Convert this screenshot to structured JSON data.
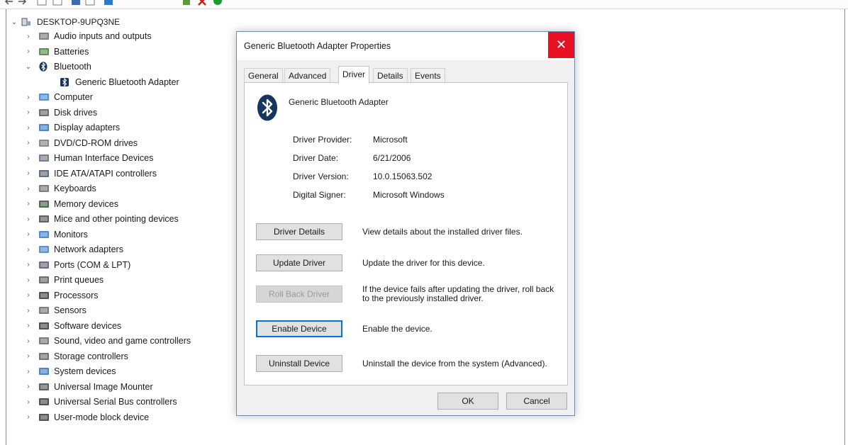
{
  "tree": {
    "root_label": "DESKTOP-9UPQ3NE",
    "categories": [
      {
        "label": "Audio inputs and outputs",
        "icon": "speaker-icon"
      },
      {
        "label": "Batteries",
        "icon": "battery-icon"
      },
      {
        "label": "Bluetooth",
        "icon": "bluetooth-icon",
        "expanded": true
      },
      {
        "label": "Computer",
        "icon": "computer-icon"
      },
      {
        "label": "Disk drives",
        "icon": "disk-drive-icon"
      },
      {
        "label": "Display adapters",
        "icon": "display-adapter-icon"
      },
      {
        "label": "DVD/CD-ROM drives",
        "icon": "dvd-drive-icon"
      },
      {
        "label": "Human Interface Devices",
        "icon": "hid-icon"
      },
      {
        "label": "IDE ATA/ATAPI controllers",
        "icon": "ide-controller-icon"
      },
      {
        "label": "Keyboards",
        "icon": "keyboard-icon"
      },
      {
        "label": "Memory devices",
        "icon": "memory-icon"
      },
      {
        "label": "Mice and other pointing devices",
        "icon": "mouse-icon"
      },
      {
        "label": "Monitors",
        "icon": "monitor-icon"
      },
      {
        "label": "Network adapters",
        "icon": "network-adapter-icon"
      },
      {
        "label": "Ports (COM & LPT)",
        "icon": "port-icon"
      },
      {
        "label": "Print queues",
        "icon": "printer-icon"
      },
      {
        "label": "Processors",
        "icon": "processor-icon"
      },
      {
        "label": "Sensors",
        "icon": "sensor-icon"
      },
      {
        "label": "Software devices",
        "icon": "software-device-icon"
      },
      {
        "label": "Sound, video and game controllers",
        "icon": "sound-controller-icon"
      },
      {
        "label": "Storage controllers",
        "icon": "storage-controller-icon"
      },
      {
        "label": "System devices",
        "icon": "system-device-icon"
      },
      {
        "label": "Universal Image Mounter",
        "icon": "image-mounter-icon"
      },
      {
        "label": "Universal Serial Bus controllers",
        "icon": "usb-icon"
      },
      {
        "label": "User-mode block device",
        "icon": "block-device-icon"
      }
    ],
    "bluetooth_child": "Generic Bluetooth Adapter"
  },
  "dialog": {
    "title": "Generic Bluetooth Adapter Properties",
    "close_glyph": "✕",
    "tabs": [
      "General",
      "Advanced",
      "Driver",
      "Details",
      "Events"
    ],
    "active_tab": "Driver",
    "device_name": "Generic Bluetooth Adapter",
    "info": [
      {
        "label": "Driver Provider:",
        "value": "Microsoft"
      },
      {
        "label": "Driver Date:",
        "value": "6/21/2006"
      },
      {
        "label": "Driver Version:",
        "value": "10.0.15063.502"
      },
      {
        "label": "Digital Signer:",
        "value": "Microsoft Windows"
      }
    ],
    "actions": [
      {
        "label": "Driver Details",
        "desc": "View details about the installed driver files.",
        "enabled": true
      },
      {
        "label": "Update Driver",
        "desc": "Update the driver for this device.",
        "enabled": true
      },
      {
        "label": "Roll Back Driver",
        "desc": "If the device fails after updating the driver, roll back to the previously installed driver.",
        "enabled": false
      },
      {
        "label": "Enable Device",
        "desc": "Enable the device.",
        "enabled": true,
        "focused": true
      },
      {
        "label": "Uninstall Device",
        "desc": "Uninstall the device from the system (Advanced).",
        "enabled": true
      }
    ],
    "ok_label": "OK",
    "cancel_label": "Cancel"
  },
  "colors": {
    "close_red": "#e81123",
    "bluetooth_navy": "#15365f",
    "focus_blue": "#0078d7"
  }
}
